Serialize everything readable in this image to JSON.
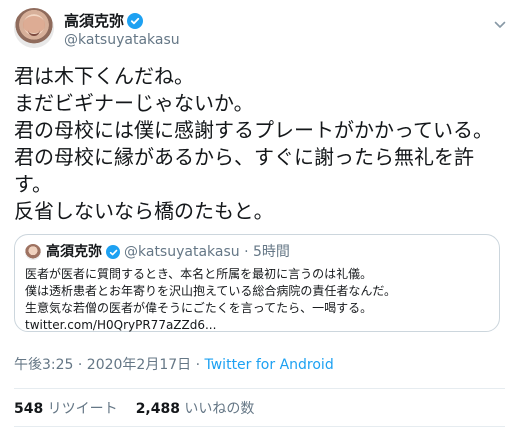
{
  "tweet": {
    "author": {
      "display_name": "高須克弥",
      "handle": "@katsuyatakasu"
    },
    "icons": {
      "avatar": "avatar-icon",
      "verified": "verified-badge-icon",
      "more": "chevron-down-icon"
    },
    "text_lines": [
      "君は木下くんだね。",
      "まだビギナーじゃないか。",
      "君の母校には僕に感謝するプレートがかかっている。",
      "君の母校に縁があるから、すぐに謝ったら無礼を許",
      "す。",
      "反省しないなら橋のたもと。"
    ],
    "quoted": {
      "display_name": "高須克弥",
      "meta": "@katsuyatakasu · 5時間",
      "lines": [
        "医者が医者に質問するとき、本名と所属を最初に言うのは礼儀。",
        "僕は透析患者とお年寄りを沢山抱えている総合病院の責任者なんだ。",
        "生意気な若僧の医者が偉そうにごたくを言ってたら、一喝する。",
        "twitter.com/H0QryPR77aZZd6..."
      ]
    },
    "timestamp": "午後3:25 · 2020年2月17日 · ",
    "client": "Twitter for Android",
    "stats": {
      "retweets_count": "548",
      "retweets_label": " リツイート",
      "likes_count": "2,488",
      "likes_label": " いいねの数"
    }
  }
}
